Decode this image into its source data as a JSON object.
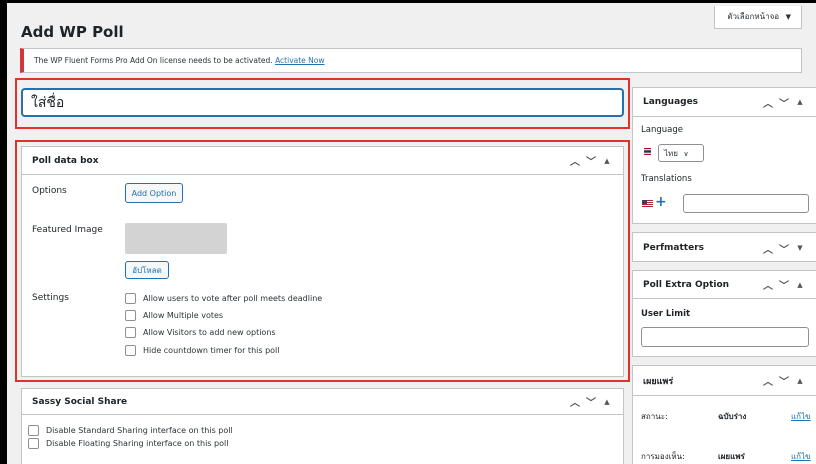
{
  "screen_options": {
    "label": "ตัวเลือกหน้าจอ",
    "arrow": "▼"
  },
  "page": {
    "title": "Add WP Poll"
  },
  "notice": {
    "text": "The WP Fluent Forms Pro Add On license needs to be activated.",
    "link": "Activate Now"
  },
  "title_field": {
    "value": "ใส่ชื่อ"
  },
  "poll_box": {
    "title": "Poll data box",
    "options_label": "Options",
    "add_option_button": "Add Option",
    "featured_image_label": "Featured Image",
    "upload_button": "อัปโหลด",
    "settings_label": "Settings",
    "settings": [
      {
        "label": "Allow users to vote after poll meets deadline",
        "checked": false
      },
      {
        "label": "Allow Multiple votes",
        "checked": false
      },
      {
        "label": "Allow Visitors to add new options",
        "checked": false
      },
      {
        "label": "Hide countdown timer for this poll",
        "checked": false
      }
    ]
  },
  "sassy_box": {
    "title": "Sassy Social Share",
    "options": [
      {
        "label": "Disable Standard Sharing interface on this poll",
        "checked": false
      },
      {
        "label": "Disable Floating Sharing interface on this poll",
        "checked": false
      }
    ]
  },
  "languages_box": {
    "title": "Languages",
    "language_label": "Language",
    "language_value": "ไทย",
    "translations_label": "Translations",
    "add_icon": "+"
  },
  "perfmatters_box": {
    "title": "Perfmatters"
  },
  "extra_box": {
    "title": "Poll Extra Option",
    "user_limit_label": "User Limit"
  },
  "publish_box": {
    "title": "เผยแพร่",
    "status_label": "สถานะ:",
    "status_value": "ฉบับร่าง",
    "status_edit": "แก้ไข",
    "visibility_label": "การมองเห็น:",
    "visibility_value": "เผยแพร่",
    "visibility_edit": "แก้ไข"
  },
  "icons": {
    "up": "chevron-up-icon",
    "down": "chevron-down-icon",
    "toggle": "triangle-toggle-icon",
    "thai_flag": "thai-flag-icon",
    "us_flag": "us-flag-icon"
  }
}
